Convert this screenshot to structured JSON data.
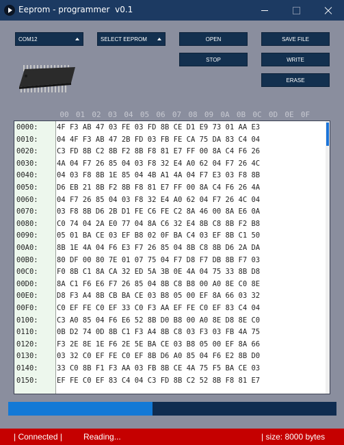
{
  "window": {
    "title": "Eeprom - programmer  v0.1"
  },
  "controls": {
    "port_select": "COM12",
    "eeprom_select": "SELECT EEPROM",
    "open_label": "OPEN",
    "stop_label": "STOP",
    "save_file_label": "SAVE FILE",
    "write_label": "WRITE",
    "erase_label": "ERASE"
  },
  "hex_view": {
    "columns": [
      "00",
      "01",
      "02",
      "03",
      "04",
      "05",
      "06",
      "07",
      "08",
      "09",
      "0A",
      "0B",
      "0C",
      "0D",
      "0E",
      "0F"
    ],
    "rows": [
      {
        "addr": "0000:",
        "bytes": "4F F3 AB 47 03 FE 03 FD 8B CE D1 E9 73 01 AA E3"
      },
      {
        "addr": "0010:",
        "bytes": "04 4F F3 AB 47 2B FD 03 FB FE CA 75 DA 83 C4 04"
      },
      {
        "addr": "0020:",
        "bytes": "C3 FD 8B C2 8B F2 8B F8 81 E7 FF 00 8A C4 F6 26"
      },
      {
        "addr": "0030:",
        "bytes": "4A 04 F7 26 85 04 03 F8 32 E4 A0 62 04 F7 26 4C"
      },
      {
        "addr": "0040:",
        "bytes": "04 03 F8 8B 1E 85 04 4B A1 4A 04 F7 E3 03 F8 8B"
      },
      {
        "addr": "0050:",
        "bytes": "D6 EB 21 8B F2 8B F8 81 E7 FF 00 8A C4 F6 26 4A"
      },
      {
        "addr": "0060:",
        "bytes": "04 F7 26 85 04 03 F8 32 E4 A0 62 04 F7 26 4C 04"
      },
      {
        "addr": "0070:",
        "bytes": "03 F8 8B D6 2B D1 FE C6 FE C2 8A 46 00 8A E6 0A"
      },
      {
        "addr": "0080:",
        "bytes": "C0 74 04 2A E0 77 04 8A C6 32 E4 8B C8 8B F2 B8"
      },
      {
        "addr": "0090:",
        "bytes": "05 01 BA CE 03 EF B8 02 0F BA C4 03 EF 8B C1 50"
      },
      {
        "addr": "00A0:",
        "bytes": "8B 1E 4A 04 F6 E3 F7 26 85 04 8B C8 8B D6 2A DA"
      },
      {
        "addr": "00B0:",
        "bytes": "80 DF 00 80 7E 01 07 75 04 F7 D8 F7 DB 8B F7 03"
      },
      {
        "addr": "00C0:",
        "bytes": "F0 8B C1 8A CA 32 ED 5A 3B 0E 4A 04 75 33 8B D8"
      },
      {
        "addr": "00D0:",
        "bytes": "8A C1 F6 E6 F7 26 85 04 8B C8 B8 00 A0 8E C0 8E"
      },
      {
        "addr": "00E0:",
        "bytes": "D8 F3 A4 8B CB BA CE 03 B8 05 00 EF 8A 66 03 32"
      },
      {
        "addr": "00F0:",
        "bytes": "C0 EF FE C0 EF 33 C0 F3 AA EF FE C0 EF 83 C4 04"
      },
      {
        "addr": "0100:",
        "bytes": "C3 A0 85 04 F6 E6 52 8B D0 B8 00 A0 8E D8 8E C0"
      },
      {
        "addr": "0110:",
        "bytes": "0B D2 74 0D 8B C1 F3 A4 8B C8 03 F3 03 FB 4A 75"
      },
      {
        "addr": "0120:",
        "bytes": "F3 2E 8E 1E F6 2E 5E BA CE 03 B8 05 00 EF 8A 66"
      },
      {
        "addr": "0130:",
        "bytes": "03 32 C0 EF FE C0 EF 8B D6 A0 85 04 F6 E2 8B D0"
      },
      {
        "addr": "0140:",
        "bytes": "33 C0 8B F1 F3 AA 03 FB 8B CE 4A 75 F5 BA CE 03"
      },
      {
        "addr": "0150:",
        "bytes": "EF FE C0 EF 83 C4 04 C3 FD 8B C2 52 8B F8 81 E7"
      }
    ]
  },
  "progress": {
    "value_fraction": 0.44
  },
  "status": {
    "connection": "| Connected |",
    "activity": "Reading...",
    "size": "| size: 8000 bytes"
  },
  "colors": {
    "titlebar": "#1c3a62",
    "button": "#13304f",
    "progress_fill": "#1379d6",
    "progress_track": "#0f2c50",
    "statusbar": "#c50000"
  }
}
